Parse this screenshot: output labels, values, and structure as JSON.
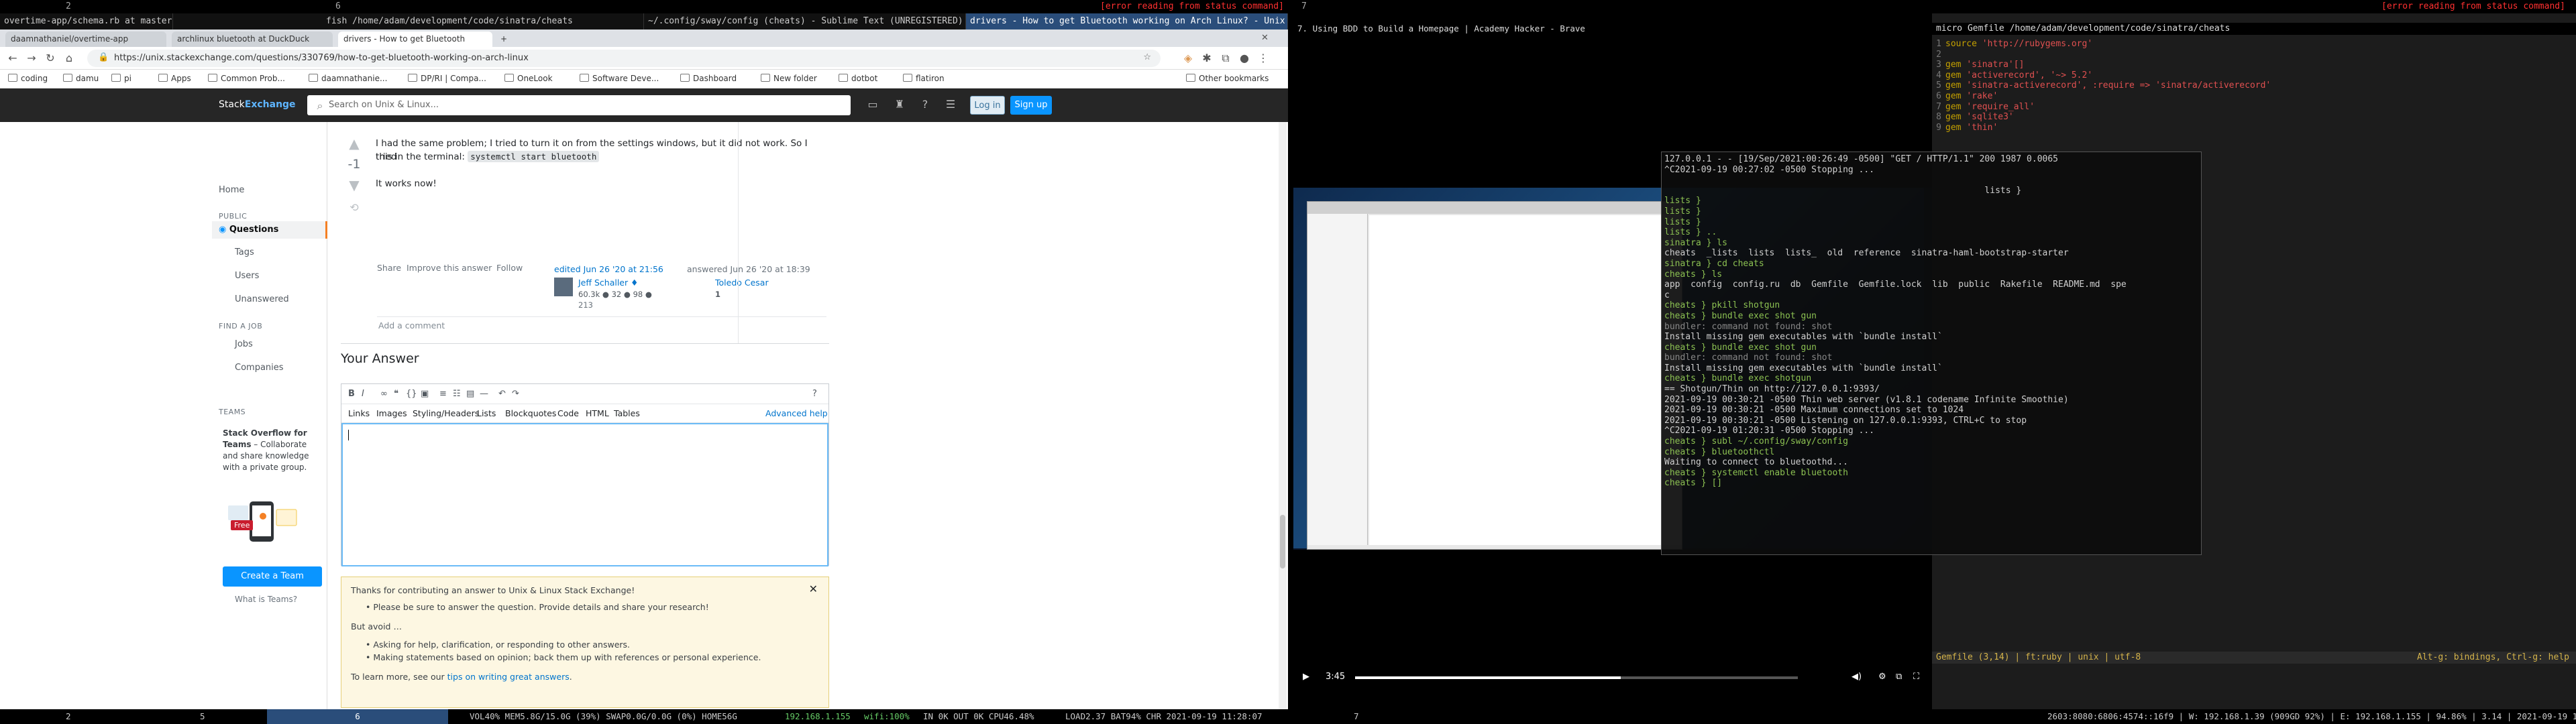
{
  "topbar": {
    "ws_left_2": "2",
    "ws_left_6": "6",
    "status_error_left": "[error reading from status command]",
    "ws_right_7": "7",
    "status_error_right": "[error reading from status command]"
  },
  "window_titles": [
    "overtime-app/schema.rb at master · jordanhudgens/overtime-a",
    "fish /home/adam/development/code/sinatra/cheats",
    "~/.config/sway/config (cheats) - Sublime Text (UNREGISTERED)",
    "drivers - How to get Bluetooth working on Arch Linux? - Unix"
  ],
  "browser": {
    "tabs": [
      "daamnathaniel/overtime-app",
      "archlinux bluetooth at DuckDuck",
      "drivers - How to get Bluetooth",
      "+"
    ],
    "close_label": "✕",
    "url": "https://unix.stackexchange.com/questions/330769/how-to-get-bluetooth-working-on-arch-linux",
    "bookmarks": [
      "coding",
      "damu",
      "pi",
      "Apps",
      "Common Prob...",
      "daamnathanie...",
      "DP/RI | Compa...",
      "OneLook",
      "Software Deve...",
      "Dashboard",
      "New folder",
      "dotbot",
      "flatiron"
    ],
    "other_bookmarks": "Other bookmarks"
  },
  "stackexchange": {
    "logo_a": "Stack",
    "logo_b": "Exchange",
    "search_placeholder": "Search on Unix & Linux...",
    "login": "Log in",
    "signup": "Sign up",
    "nav": {
      "home": "Home",
      "public": "PUBLIC",
      "questions": "Questions",
      "tags": "Tags",
      "users": "Users",
      "unanswered": "Unanswered",
      "find_job": "FIND A JOB",
      "jobs": "Jobs",
      "companies": "Companies",
      "teams": "TEAMS",
      "teams_promo_title": "Stack Overflow for Teams",
      "teams_promo_body": " – Collaborate and share knowledge with a private group.",
      "free_badge": "Free",
      "create_team": "Create a Team",
      "what_is_teams": "What is Teams?"
    },
    "answer": {
      "score": "-1",
      "text_line1": "I had the same problem; I tried to turn it on from the settings windows, but it did not work. So I tried",
      "text_line2_pre": "this in the terminal: ",
      "code": "systemctl start bluetooth",
      "text_line3": "It works now!",
      "share": "Share",
      "improve": "Improve this answer",
      "follow": "Follow",
      "edited": "edited Jun 26 '20 at 21:56",
      "editor_name": "Jeff Schaller ♦",
      "editor_rep": "60.3k ● 32 ● 98 ●",
      "editor_rep2": "213",
      "answered": "answered Jun 26 '20 at 18:39",
      "answerer_name": "Toledo Cesar",
      "answerer_rep": "1",
      "add_comment": "Add a comment"
    },
    "your_answer": "Your Answer",
    "editor_tabs": [
      "Links",
      "Images",
      "Styling/Headers",
      "Lists",
      "Blockquotes",
      "Code",
      "HTML",
      "Tables"
    ],
    "advanced_help": "Advanced help",
    "notice": {
      "title": "Thanks for contributing an answer to Unix & Linux Stack Exchange!",
      "bullet1": "Please be sure to answer the question. Provide details and share your research!",
      "but_avoid": "But avoid …",
      "bullet2": "Asking for help, clarification, or responding to other answers.",
      "bullet3": "Making statements based on opinion; back them up with references or personal experience.",
      "footer_pre": "To learn more, see our ",
      "footer_link": "tips on writing great answers",
      "footer_post": "."
    }
  },
  "brave": {
    "title": "7. Using BDD to Build a Homepage | Academy Hacker - Brave",
    "video_time": "3:45",
    "video_progress": 0.6
  },
  "terminal": {
    "lines": [
      {
        "t": "127.0.0.1 - - [19/Sep/2021:00:26:49 -0500] \"GET / HTTP/1.1\" 200 1987 0.0065",
        "c": ""
      },
      {
        "t": "^C2021-09-19 00:27:02 -0500 Stopping ...",
        "c": ""
      },
      {
        "t": "",
        "c": ""
      },
      {
        "t": "                                                             lists }",
        "c": ""
      },
      {
        "t": "lists }",
        "c": "tg"
      },
      {
        "t": "lists }",
        "c": "tg"
      },
      {
        "t": "lists }",
        "c": "tg"
      },
      {
        "t": "lists } ..",
        "c": "tg"
      },
      {
        "t": "sinatra } ls",
        "c": "tg"
      },
      {
        "t": "cheats  _lists  lists  lists_  old  reference  sinatra-haml-bootstrap-starter",
        "c": ""
      },
      {
        "t": "sinatra } cd cheats",
        "c": "tg"
      },
      {
        "t": "cheats } ls",
        "c": "tg"
      },
      {
        "t": "app  config  config.ru  db  Gemfile  Gemfile.lock  lib  public  Rakefile  README.md  spe",
        "c": ""
      },
      {
        "t": "c",
        "c": ""
      },
      {
        "t": "cheats } pkill shotgun",
        "c": "tg"
      },
      {
        "t": "cheats } bundle exec shot gun",
        "c": "tg"
      },
      {
        "t": "bundler: command not found: shot",
        "c": "td"
      },
      {
        "t": "Install missing gem executables with `bundle install`",
        "c": ""
      },
      {
        "t": "cheats } bundle exec shot gun",
        "c": "tg"
      },
      {
        "t": "bundler: command not found: shot",
        "c": "td"
      },
      {
        "t": "Install missing gem executables with `bundle install`",
        "c": ""
      },
      {
        "t": "cheats } bundle exec shotgun",
        "c": "tg"
      },
      {
        "t": "== Shotgun/Thin on http://127.0.0.1:9393/",
        "c": ""
      },
      {
        "t": "2021-09-19 00:30:21 -0500 Thin web server (v1.8.1 codename Infinite Smoothie)",
        "c": ""
      },
      {
        "t": "2021-09-19 00:30:21 -0500 Maximum connections set to 1024",
        "c": ""
      },
      {
        "t": "2021-09-19 00:30:21 -0500 Listening on 127.0.0.1:9393, CTRL+C to stop",
        "c": ""
      },
      {
        "t": "^C2021-09-19 01:20:31 -0500 Stopping ...",
        "c": ""
      },
      {
        "t": "cheats } subl ~/.config/sway/config",
        "c": "tg"
      },
      {
        "t": "cheats } bluetoothctl",
        "c": "tg"
      },
      {
        "t": "Waiting to connect to bluetoothd...",
        "c": ""
      },
      {
        "t": "cheats } systemctl enable bluetooth",
        "c": "tg"
      },
      {
        "t": "cheats } []",
        "c": "tg"
      }
    ]
  },
  "micro": {
    "title": "micro Gemfile /home/adam/development/code/sinatra/cheats",
    "lines": [
      {
        "n": "1",
        "a": "source ",
        "b": "'http://rubygems.org'"
      },
      {
        "n": "2",
        "a": "",
        "b": ""
      },
      {
        "n": "3",
        "a": "gem ",
        "b": "'sinatra'[]"
      },
      {
        "n": "4",
        "a": "gem ",
        "b": "'activerecord', '~> 5.2'"
      },
      {
        "n": "5",
        "a": "gem ",
        "b": "'sinatra-activerecord', :require => 'sinatra/activerecord'"
      },
      {
        "n": "6",
        "a": "gem ",
        "b": "'rake'"
      },
      {
        "n": "7",
        "a": "gem ",
        "b": "'require_all'"
      },
      {
        "n": "8",
        "a": "gem ",
        "b": "'sqlite3'"
      },
      {
        "n": "9",
        "a": "gem ",
        "b": "'thin'"
      }
    ],
    "status_left": "Gemfile (3,14) | ft:ruby | unix | utf-8",
    "status_right": "Alt-g: bindings, Ctrl-g: help"
  },
  "bottombar": {
    "ws2": "2",
    "ws5": "5",
    "ws6": "6",
    "stats": "VOL40%  MEM5.8G/15.0G (39%)  SWAP0.0G/0.0G (0%)  HOME56G",
    "ip": "192.168.1.155",
    "wifi": "wifi:100%",
    "net": "IN 0K OUT 0K  CPU46.48%",
    "load": "LOAD2.37  BAT94% CHR  2021-09-19 11:28:07",
    "ws7": "7",
    "right_stats": "2603:8080:6806:4574::16f9 | W: 192.168.1.39 (909GD  92%) | E: 192.168.1.155 | 94.86% | 3.14 | 2021-09-19 11:28:07"
  }
}
